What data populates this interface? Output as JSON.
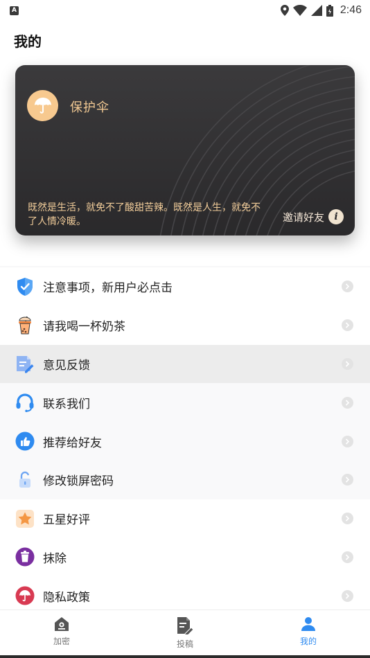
{
  "status_bar": {
    "notification_letter": "A",
    "time": "2:46",
    "icons": [
      "location-icon",
      "wifi-icon",
      "signal-icon",
      "battery-icon"
    ]
  },
  "header": {
    "title": "我的"
  },
  "card": {
    "name": "保护伞",
    "quote": "既然是生活，就免不了酸甜苦辣。既然是人生，就免不了人情冷暖。",
    "invite_label": "邀请好友",
    "info_glyph": "i",
    "colors": {
      "background": "#2f2e30",
      "accent": "#f2c993"
    }
  },
  "menu": {
    "items": [
      {
        "label": "注意事项，新用户必点击",
        "icon": "shield-check-icon"
      },
      {
        "label": "请我喝一杯奶茶",
        "icon": "milk-tea-icon"
      },
      {
        "label": "意见反馈",
        "icon": "feedback-edit-icon"
      },
      {
        "label": "联系我们",
        "icon": "headset-icon"
      },
      {
        "label": "推荐给好友",
        "icon": "thumbs-up-icon"
      },
      {
        "label": "修改锁屏密码",
        "icon": "unlock-icon"
      },
      {
        "label": "五星好评",
        "icon": "star-icon"
      },
      {
        "label": "抹除",
        "icon": "trash-icon"
      },
      {
        "label": "隐私政策",
        "icon": "umbrella-icon"
      }
    ]
  },
  "bottom_nav": {
    "items": [
      {
        "label": "加密",
        "icon": "home-lock-icon",
        "active": false
      },
      {
        "label": "投稿",
        "icon": "document-edit-icon",
        "active": false
      },
      {
        "label": "我的",
        "icon": "user-icon",
        "active": true
      }
    ],
    "active_color": "#2f8bf0"
  }
}
